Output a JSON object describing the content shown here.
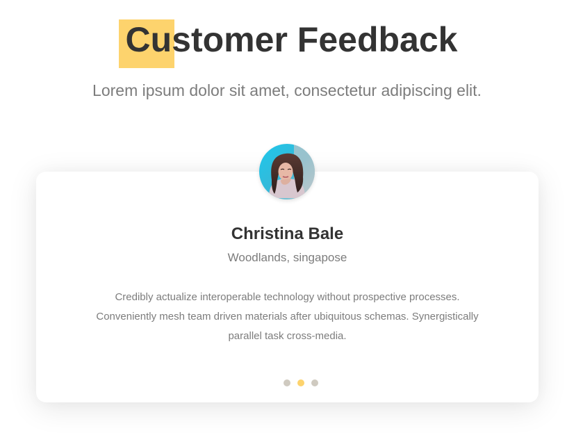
{
  "header": {
    "title": "Customer Feedback",
    "subtitle": "Lorem ipsum dolor sit amet, consectetur adipiscing elit."
  },
  "testimonial": {
    "avatar_icon": "customer-avatar",
    "name": "Christina Bale",
    "location": "Woodlands, singapose",
    "quote_lines": [
      "Credibly actualize interoperable technology without prospective processes.",
      "Conveniently mesh team driven materials after ubiquitous schemas. Synergistically",
      "parallel task cross-media."
    ]
  },
  "carousel": {
    "current_slide": 2,
    "slide_count": 3
  },
  "colors": {
    "accent": "#fdd36d",
    "heading": "#333333",
    "text": "#7c7c7c",
    "inactive_dot": "#cfcac0",
    "background": "#ffffff"
  }
}
